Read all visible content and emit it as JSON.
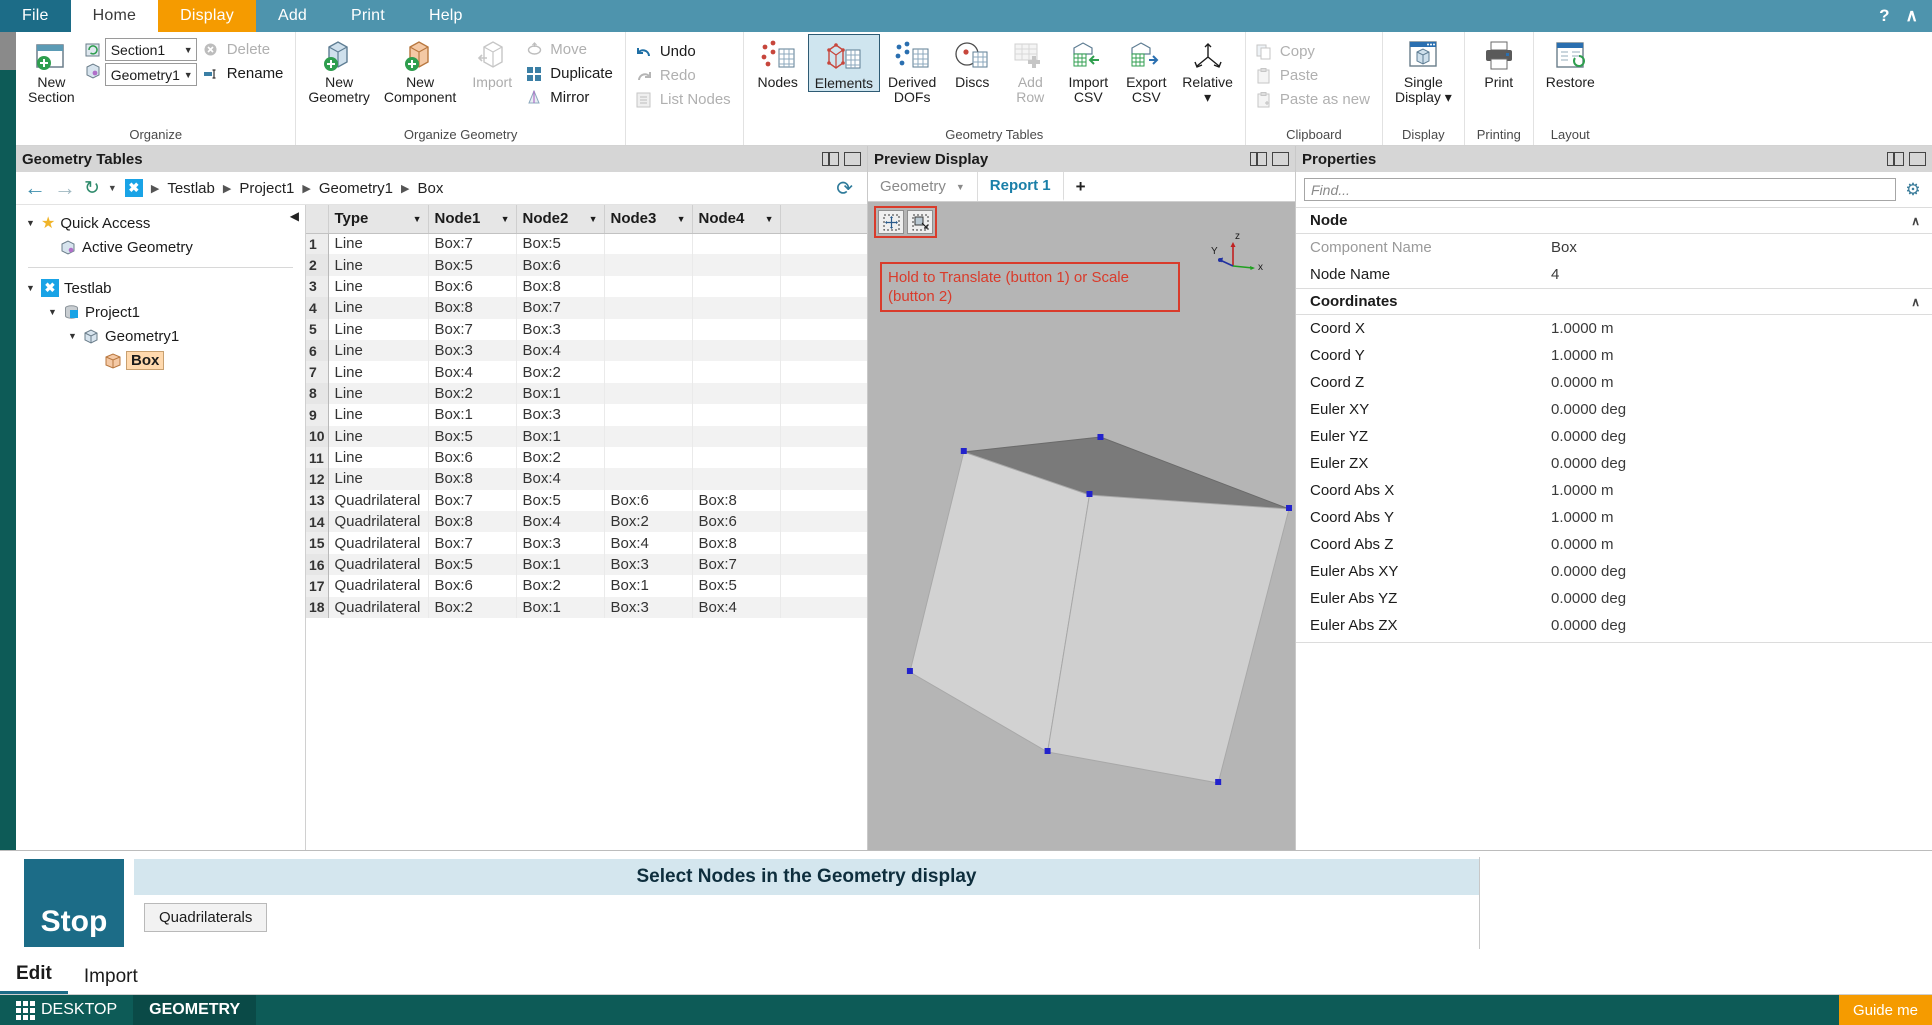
{
  "menubar": {
    "tabs": [
      {
        "label": "File",
        "state": "file"
      },
      {
        "label": "Home",
        "state": "active-home"
      },
      {
        "label": "Display",
        "state": "active-display"
      },
      {
        "label": "Add",
        "state": "normal"
      },
      {
        "label": "Print",
        "state": "normal"
      },
      {
        "label": "Help",
        "state": "normal"
      }
    ],
    "help_icon": "?",
    "collapse_icon": "∧"
  },
  "ribbon": {
    "groups": [
      {
        "title": "Organize",
        "big": [
          {
            "label_line1": "New",
            "label_line2": "Section",
            "icon": "new-section-icon"
          }
        ],
        "combos": [
          {
            "value": "Section1",
            "name": "section-combo"
          },
          {
            "value": "Geometry1",
            "name": "geometry-combo"
          }
        ],
        "small": [
          {
            "label": "Delete",
            "icon": "delete-icon",
            "disabled": true
          },
          {
            "label": "Rename",
            "icon": "rename-icon",
            "disabled": false
          }
        ]
      },
      {
        "title": "Organize Geometry",
        "big": [
          {
            "label_line1": "New",
            "label_line2": "Geometry",
            "icon": "new-geometry-icon"
          },
          {
            "label_line1": "New",
            "label_line2": "Component",
            "icon": "new-component-icon"
          },
          {
            "label_line1": "Import",
            "label_line2": "",
            "icon": "import-icon",
            "disabled": true
          }
        ],
        "small": [
          {
            "label": "Move",
            "icon": "move-icon",
            "disabled": true
          },
          {
            "label": "Duplicate",
            "icon": "duplicate-icon",
            "disabled": false
          },
          {
            "label": "Mirror",
            "icon": "mirror-icon",
            "disabled": false
          }
        ]
      },
      {
        "title": "",
        "small": [
          {
            "label": "Undo",
            "icon": "undo-icon",
            "disabled": false
          },
          {
            "label": "Redo",
            "icon": "redo-icon",
            "disabled": true
          },
          {
            "label": "List Nodes",
            "icon": "list-nodes-icon",
            "disabled": true
          }
        ]
      },
      {
        "title": "Geometry Tables",
        "big": [
          {
            "label_line1": "Nodes",
            "label_line2": "",
            "icon": "nodes-icon"
          },
          {
            "label_line1": "Elements",
            "label_line2": "",
            "icon": "elements-icon",
            "selected": true
          },
          {
            "label_line1": "Derived",
            "label_line2": "DOFs",
            "icon": "derived-dofs-icon"
          },
          {
            "label_line1": "Discs",
            "label_line2": "",
            "icon": "discs-icon"
          },
          {
            "label_line1": "Add",
            "label_line2": "Row",
            "icon": "add-row-icon",
            "disabled": true
          },
          {
            "label_line1": "Import",
            "label_line2": "CSV",
            "icon": "import-csv-icon"
          },
          {
            "label_line1": "Export",
            "label_line2": "CSV",
            "icon": "export-csv-icon"
          },
          {
            "label_line1": "Relative",
            "label_line2": "▾",
            "icon": "relative-icon"
          }
        ]
      },
      {
        "title": "Clipboard",
        "small": [
          {
            "label": "Copy",
            "icon": "copy-icon",
            "disabled": true
          },
          {
            "label": "Paste",
            "icon": "paste-icon",
            "disabled": true
          },
          {
            "label": "Paste as new",
            "icon": "paste-as-new-icon",
            "disabled": true
          }
        ]
      },
      {
        "title": "Display",
        "big": [
          {
            "label_line1": "Single",
            "label_line2": "Display ▾",
            "icon": "single-display-icon"
          }
        ]
      },
      {
        "title": "Printing",
        "big": [
          {
            "label_line1": "Print",
            "label_line2": "",
            "icon": "printer-icon"
          }
        ]
      },
      {
        "title": "Layout",
        "big": [
          {
            "label_line1": "Restore",
            "label_line2": "",
            "icon": "restore-icon"
          }
        ]
      }
    ]
  },
  "geometry_tables": {
    "title": "Geometry Tables",
    "breadcrumb": [
      "Testlab",
      "Project1",
      "Geometry1",
      "Box"
    ],
    "tree": {
      "quick_access": {
        "label": "Quick Access",
        "children": [
          {
            "label": "Active Geometry"
          }
        ]
      },
      "root": {
        "label": "Testlab",
        "children": [
          {
            "label": "Project1",
            "children": [
              {
                "label": "Geometry1",
                "children": [
                  {
                    "label": "Box",
                    "selected": true
                  }
                ]
              }
            ]
          }
        ]
      }
    },
    "table": {
      "columns": [
        "Type",
        "Node1",
        "Node2",
        "Node3",
        "Node4"
      ],
      "rows": [
        {
          "n": "1",
          "Type": "Line",
          "Node1": "Box:7",
          "Node2": "Box:5",
          "Node3": "",
          "Node4": ""
        },
        {
          "n": "2",
          "Type": "Line",
          "Node1": "Box:5",
          "Node2": "Box:6",
          "Node3": "",
          "Node4": ""
        },
        {
          "n": "3",
          "Type": "Line",
          "Node1": "Box:6",
          "Node2": "Box:8",
          "Node3": "",
          "Node4": ""
        },
        {
          "n": "4",
          "Type": "Line",
          "Node1": "Box:8",
          "Node2": "Box:7",
          "Node3": "",
          "Node4": ""
        },
        {
          "n": "5",
          "Type": "Line",
          "Node1": "Box:7",
          "Node2": "Box:3",
          "Node3": "",
          "Node4": ""
        },
        {
          "n": "6",
          "Type": "Line",
          "Node1": "Box:3",
          "Node2": "Box:4",
          "Node3": "",
          "Node4": ""
        },
        {
          "n": "7",
          "Type": "Line",
          "Node1": "Box:4",
          "Node2": "Box:2",
          "Node3": "",
          "Node4": ""
        },
        {
          "n": "8",
          "Type": "Line",
          "Node1": "Box:2",
          "Node2": "Box:1",
          "Node3": "",
          "Node4": ""
        },
        {
          "n": "9",
          "Type": "Line",
          "Node1": "Box:1",
          "Node2": "Box:3",
          "Node3": "",
          "Node4": ""
        },
        {
          "n": "10",
          "Type": "Line",
          "Node1": "Box:5",
          "Node2": "Box:1",
          "Node3": "",
          "Node4": ""
        },
        {
          "n": "11",
          "Type": "Line",
          "Node1": "Box:6",
          "Node2": "Box:2",
          "Node3": "",
          "Node4": ""
        },
        {
          "n": "12",
          "Type": "Line",
          "Node1": "Box:8",
          "Node2": "Box:4",
          "Node3": "",
          "Node4": ""
        },
        {
          "n": "13",
          "Type": "Quadrilateral",
          "Node1": "Box:7",
          "Node2": "Box:5",
          "Node3": "Box:6",
          "Node4": "Box:8"
        },
        {
          "n": "14",
          "Type": "Quadrilateral",
          "Node1": "Box:8",
          "Node2": "Box:4",
          "Node3": "Box:2",
          "Node4": "Box:6"
        },
        {
          "n": "15",
          "Type": "Quadrilateral",
          "Node1": "Box:7",
          "Node2": "Box:3",
          "Node3": "Box:4",
          "Node4": "Box:8"
        },
        {
          "n": "16",
          "Type": "Quadrilateral",
          "Node1": "Box:5",
          "Node2": "Box:1",
          "Node3": "Box:3",
          "Node4": "Box:7"
        },
        {
          "n": "17",
          "Type": "Quadrilateral",
          "Node1": "Box:6",
          "Node2": "Box:2",
          "Node3": "Box:1",
          "Node4": "Box:5"
        },
        {
          "n": "18",
          "Type": "Quadrilateral",
          "Node1": "Box:2",
          "Node2": "Box:1",
          "Node3": "Box:3",
          "Node4": "Box:4"
        }
      ]
    }
  },
  "preview": {
    "title": "Preview Display",
    "tabs": [
      {
        "label": "Geometry",
        "active": false,
        "has_caret": true
      },
      {
        "label": "Report 1",
        "active": true,
        "has_caret": false
      }
    ],
    "add_tab": "+",
    "hint": "Hold to Translate (button 1) or Scale (button 2)",
    "axis_labels": {
      "x": "x",
      "y": "Y",
      "z": "z"
    }
  },
  "properties": {
    "title": "Properties",
    "find_placeholder": "Find...",
    "groups": [
      {
        "label": "Node",
        "rows": [
          {
            "name": "Component Name",
            "value": "Box",
            "dim": true
          },
          {
            "name": "Node Name",
            "value": "4",
            "dim": false
          }
        ]
      },
      {
        "label": "Coordinates",
        "rows": [
          {
            "name": "Coord X",
            "value": "1.0000 m"
          },
          {
            "name": "Coord Y",
            "value": "1.0000 m"
          },
          {
            "name": "Coord Z",
            "value": "0.0000 m"
          },
          {
            "name": "Euler XY",
            "value": "0.0000 deg"
          },
          {
            "name": "Euler YZ",
            "value": "0.0000 deg"
          },
          {
            "name": "Euler ZX",
            "value": "0.0000 deg"
          },
          {
            "name": "Coord Abs X",
            "value": "1.0000 m"
          },
          {
            "name": "Coord Abs Y",
            "value": "1.0000 m"
          },
          {
            "name": "Coord Abs Z",
            "value": "0.0000 m"
          },
          {
            "name": "Euler Abs XY",
            "value": "0.0000 deg"
          },
          {
            "name": "Euler Abs YZ",
            "value": "0.0000 deg"
          },
          {
            "name": "Euler Abs ZX",
            "value": "0.0000 deg"
          }
        ]
      }
    ]
  },
  "bottom": {
    "stop_label": "Stop",
    "message": "Select Nodes in the Geometry display",
    "chips": [
      "Quadrilaterals"
    ]
  },
  "edit_tabs": [
    {
      "label": "Edit",
      "active": true
    },
    {
      "label": "Import",
      "active": false
    }
  ],
  "statusbar": {
    "items": [
      {
        "label": "DESKTOP",
        "active": false
      },
      {
        "label": "GEOMETRY",
        "active": true
      }
    ],
    "guide_label": "Guide me"
  }
}
